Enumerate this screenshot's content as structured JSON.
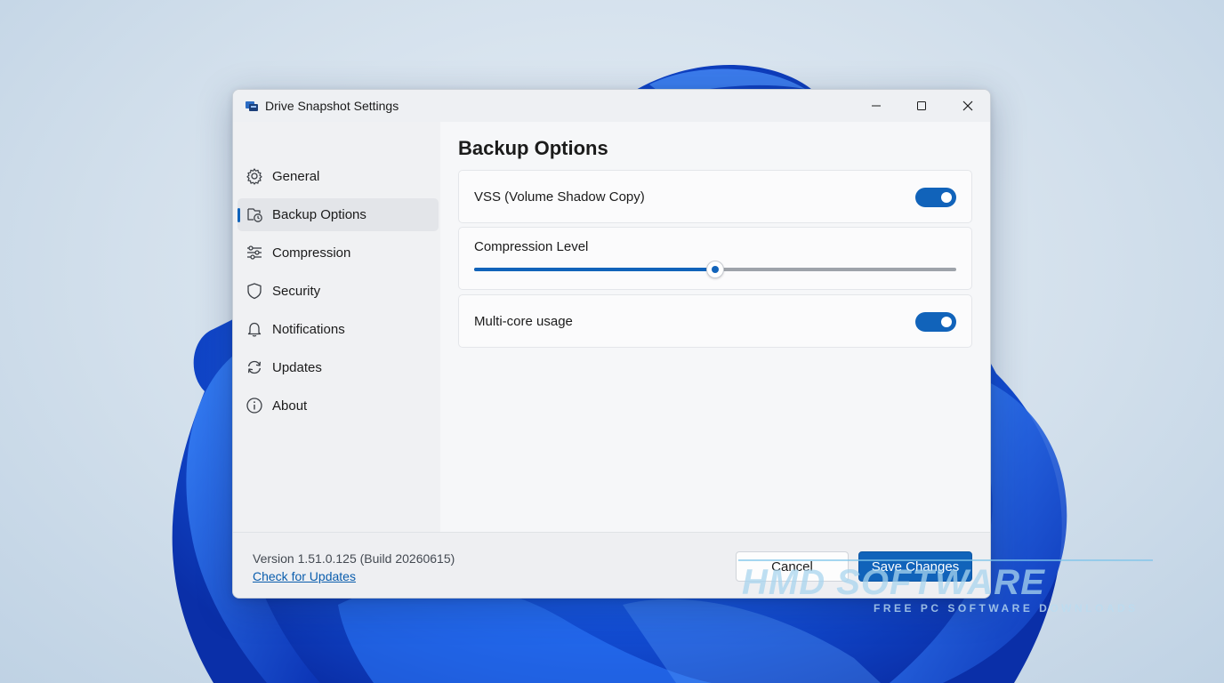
{
  "window": {
    "title": "Drive Snapshot Settings",
    "controls": {
      "minimize_icon": "minimize-icon",
      "maximize_icon": "maximize-icon",
      "close_icon": "close-icon"
    }
  },
  "sidebar": {
    "items": [
      {
        "label": "General",
        "icon": "gear-icon",
        "active": false
      },
      {
        "label": "Backup Options",
        "icon": "backup-clock-icon",
        "active": true
      },
      {
        "label": "Compression",
        "icon": "sliders-icon",
        "active": false
      },
      {
        "label": "Security",
        "icon": "shield-icon",
        "active": false
      },
      {
        "label": "Notifications",
        "icon": "bell-icon",
        "active": false
      },
      {
        "label": "Updates",
        "icon": "refresh-icon",
        "active": false
      },
      {
        "label": "About",
        "icon": "info-icon",
        "active": false
      }
    ]
  },
  "main": {
    "title": "Backup Options",
    "settings": [
      {
        "label": "VSS (Volume Shadow Copy)",
        "type": "toggle",
        "value": true
      },
      {
        "label": "Compression Level",
        "type": "slider",
        "value": 0.5
      },
      {
        "label": "Multi-core usage",
        "type": "toggle",
        "value": true
      }
    ]
  },
  "footer": {
    "version": "Version 1.51.0.125 (Build 20260615)",
    "check_updates": "Check for Updates",
    "cancel": "Cancel",
    "save": "Save Changes"
  },
  "watermark": {
    "brand": "HMD SOFTWARE",
    "tagline": "FREE PC SOFTWARE DOWNLOADS"
  },
  "colors": {
    "accent": "#1163ba",
    "window_bg": "#f3f4f6",
    "wallpaper_blue": "#1a4fd6"
  }
}
